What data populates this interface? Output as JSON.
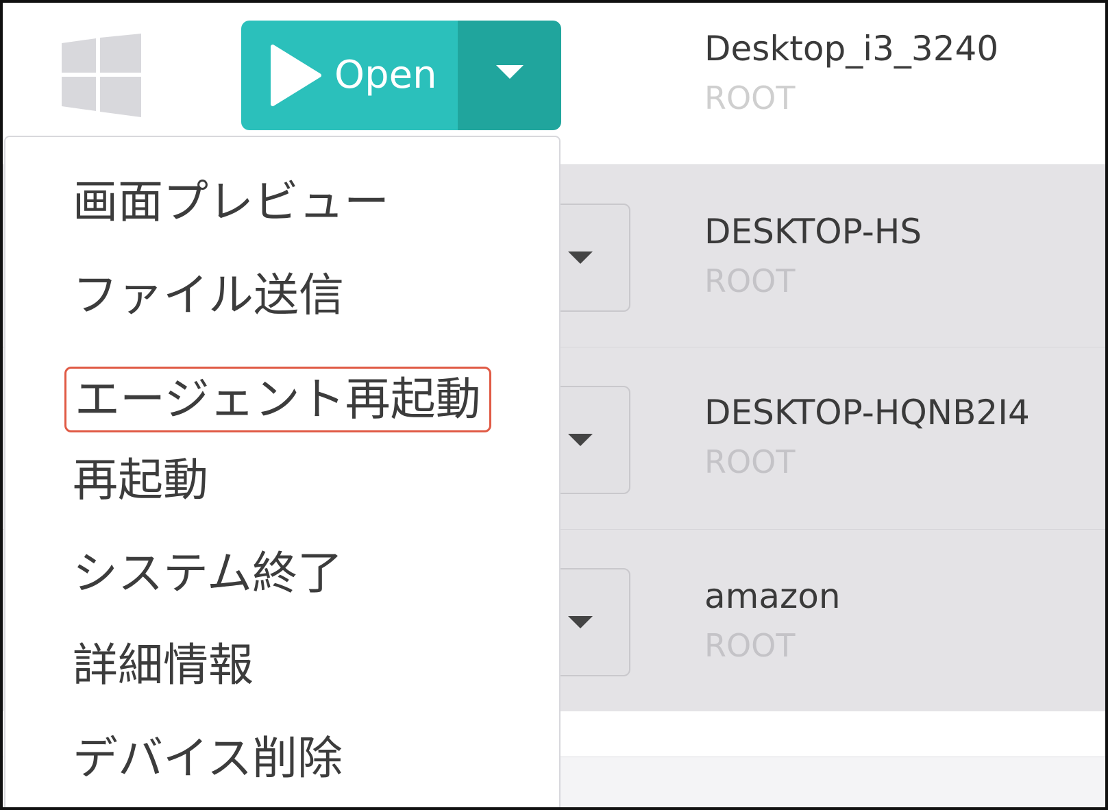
{
  "toolbar": {
    "os_icon": "windows-logo-icon",
    "open_button": {
      "label": "Open",
      "icon": "play-icon",
      "caret_icon": "caret-down-icon",
      "color": "#2bc0bb",
      "caret_color": "#20a59d"
    }
  },
  "devices": [
    {
      "name": "Desktop_i3_3240",
      "group": "ROOT"
    },
    {
      "name": "DESKTOP-HS",
      "group": "ROOT"
    },
    {
      "name": "DESKTOP-HQNB2I4",
      "group": "ROOT"
    },
    {
      "name": "amazon",
      "group": "ROOT"
    }
  ],
  "menu": {
    "items": [
      {
        "label": "画面プレビュー"
      },
      {
        "label": "ファイル送信"
      },
      {
        "label": "エージェント再起動",
        "highlighted": true
      },
      {
        "label": "再起動"
      },
      {
        "label": "システム終了"
      },
      {
        "label": "詳細情報"
      },
      {
        "label": "デバイス削除"
      }
    ],
    "highlight_color": "#e05a45"
  }
}
